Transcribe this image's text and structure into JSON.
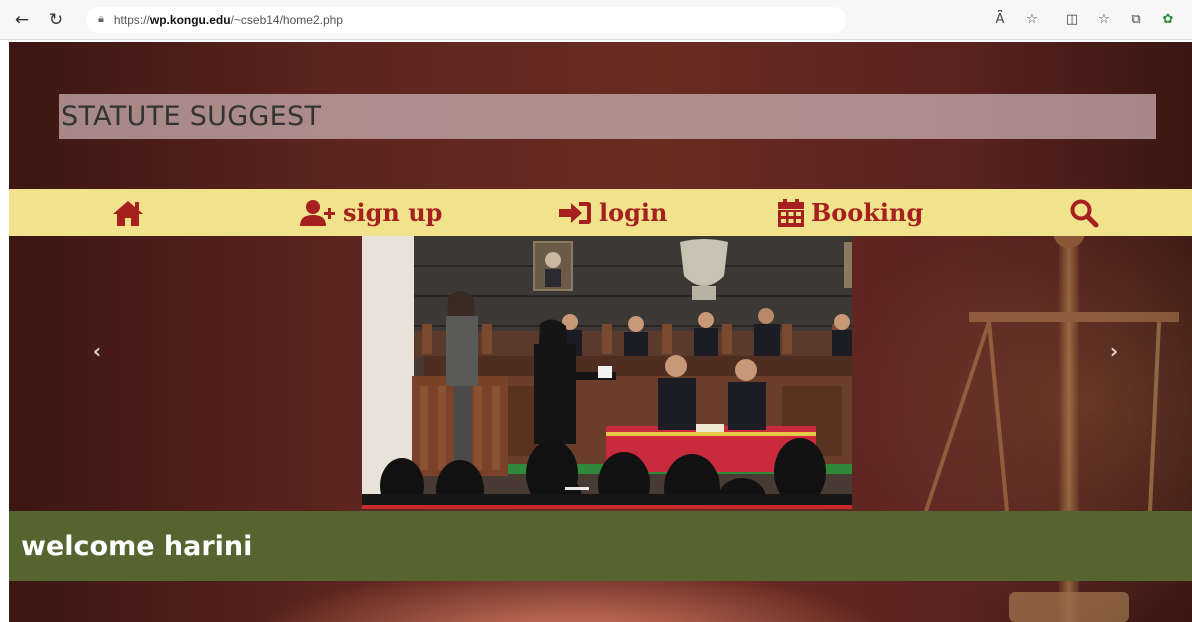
{
  "browser": {
    "url_prefix": "https://",
    "url_domain": "wp.kongu.edu",
    "url_path": "/~cseb14/home2.php",
    "icons": [
      "back-arrow-icon",
      "refresh-icon",
      "lock-icon",
      "read-aloud-icon",
      "favorite-star-icon",
      "split-screen-icon",
      "favorites-icon",
      "collections-icon",
      "extensions-icon"
    ]
  },
  "header": {
    "title": "STATUTE SUGGEST"
  },
  "nav": {
    "items": [
      {
        "label": "",
        "icon": "home-icon"
      },
      {
        "label": "sign up",
        "icon": "user-plus-icon"
      },
      {
        "label": "login",
        "icon": "sign-in-icon"
      },
      {
        "label": "Booking",
        "icon": "calendar-icon"
      },
      {
        "label": "",
        "icon": "search-icon"
      }
    ],
    "color": "#a62020",
    "background": "#f1e28c"
  },
  "carousel": {
    "prev_label": "‹",
    "next_label": "›",
    "active_index": 0
  },
  "welcome": {
    "text": "welcome harini",
    "background": "#566430"
  }
}
